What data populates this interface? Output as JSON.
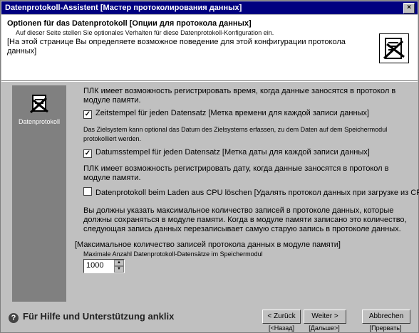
{
  "window": {
    "title": "Datenprotokoll-Assistent [Мастер протоколирования данных]",
    "close": "×"
  },
  "header": {
    "title": "Optionen für das Datenprotokoll [Опции для протокола данных]",
    "subtitle_de": "Auf dieser Seite stellen Sie optionales Verhalten für diese Datenprotokoll-Konfiguration ein.",
    "subtitle_ru": "[На этой странице Вы определяете возможное  поведение для этой конфигурации протокола данных]"
  },
  "sidebar": {
    "label": "Datenprotokoll"
  },
  "main": {
    "p1": "ПЛК имеет возможность регистрировать время, когда данные заносятся в протокол в модуле памяти.",
    "cb1": {
      "label": "Zeitstempel für jeden Datensatz  [Метка времени для каждой записи данных]",
      "checked": true
    },
    "p2": "Das Zielsystem kann optional das Datum des Zielsystems erfassen, zu dem Daten auf dem Speichermodul protokolliert werden.",
    "cb2": {
      "label": "Datumsstempel für jeden Datensatz  [Метка даты для каждой записи данных]",
      "checked": true
    },
    "p3": "ПЛК имеет возможность регистрировать дату, когда данные заносятся в протокол в модуле памяти.",
    "cb3": {
      "label": "Datenprotokoll beim Laden aus CPU löschen  [Удалять протокол данных при загрузке из CPU]",
      "checked": false
    },
    "p4": "Вы должны указать максимальное количество записей в протоколе данных, которые должны сохраняться в модуле памяти. Когда в модуле памяти записано это количество, следующая запись данных перезаписывает самую старую запись в протоколе данных.",
    "p5_ru": "[Максимальное количество записей протокола данных в модуле памяти]",
    "p5_de": "Maximale Anzahl Datenprotokoll-Datensätze im Speichermodul",
    "spin_value": "1000"
  },
  "footer": {
    "help": "Für Hilfe und Unterstützung anklix",
    "back": "< Zurück",
    "back_ru": "[<Назад]",
    "next": "Weiter >",
    "next_ru": "[Дальше>]",
    "cancel": "Abbrechen",
    "cancel_ru": "[Прервать]"
  }
}
